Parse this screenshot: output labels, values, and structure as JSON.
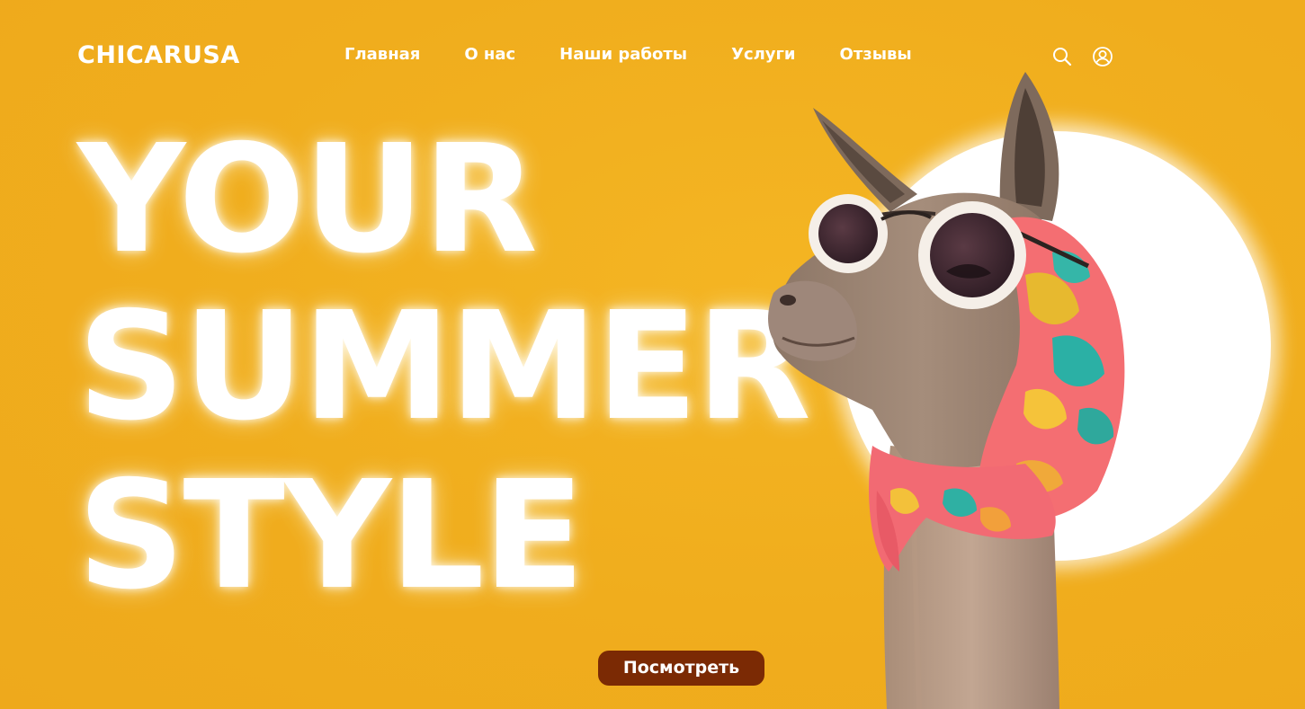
{
  "header": {
    "logo": "CHICARUSA",
    "nav": [
      {
        "label": "Главная"
      },
      {
        "label": "О нас"
      },
      {
        "label": "Наши работы"
      },
      {
        "label": "Услуги"
      },
      {
        "label": "Отзывы"
      }
    ],
    "icons": [
      "search-icon",
      "user-icon"
    ]
  },
  "hero": {
    "lines": [
      "YOUR",
      "SUMMER",
      "STYLE"
    ],
    "cta_label": "Посмотреть",
    "image": "llama-in-sunglasses-and-headscarf"
  },
  "colors": {
    "background": "#f0ae1c",
    "text": "#ffffff",
    "cta_background": "#7b2a04",
    "sun": "#ffffff"
  }
}
